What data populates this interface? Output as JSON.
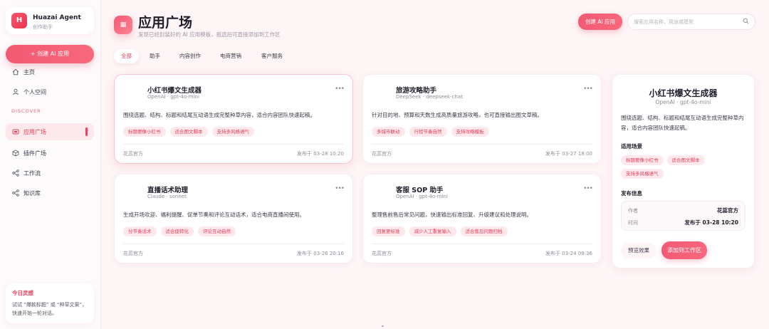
{
  "brand": {
    "logo_letter": "H",
    "name": "Huazai Agent",
    "subtitle": "创作助手"
  },
  "sidebar": {
    "create_label": "+  创建 AI 应用",
    "items_top": [
      {
        "label": "主页",
        "icon": "home-icon"
      },
      {
        "label": "个人空间",
        "icon": "user-icon"
      }
    ],
    "section_label": "DISCOVER",
    "items_discover": [
      {
        "label": "应用广场",
        "icon": "app-square-icon",
        "active": true
      },
      {
        "label": "插件广场",
        "icon": "cube-icon"
      },
      {
        "label": "工作流",
        "icon": "workflow-icon"
      },
      {
        "label": "知识库",
        "icon": "knowledge-icon"
      }
    ],
    "tip": {
      "title": "今日灵感",
      "text": "试试 “爆款标题” 或 “种草文案”，快速开始一轮对话。"
    }
  },
  "header": {
    "icon_glyph": "▦",
    "title": "应用广场",
    "subtitle": "发现已经封装好的 AI 应用模板，挑选后可直接添加到工作区",
    "create_button": "创建 AI 应用",
    "search_placeholder": "搜索应用名称、用途或模型"
  },
  "tabs": [
    {
      "label": "全部",
      "active": true
    },
    {
      "label": "助手"
    },
    {
      "label": "内容创作"
    },
    {
      "label": "电商营销"
    },
    {
      "label": "客户服务"
    }
  ],
  "cards": [
    {
      "title": "小红书爆文生成器",
      "model": "OpenAI · gpt-4o-mini",
      "description": "围绕选题、结构、标题和结尾互动语生成完整种草内容，适合内容团队快速起稿。",
      "tags": [
        "标题要像小红书",
        "适合图文脚本",
        "支持多风格语气"
      ],
      "author": "花蕊官方",
      "date": "发布于 03-28 10:20"
    },
    {
      "title": "旅游攻略助手",
      "model": "DeepSeek · deepseek-chat",
      "description": "针对目的地、预算和天数生成高质量旅游攻略，也可直接输出图文草稿。",
      "tags": [
        "多城市联动",
        "行程节奏自然",
        "支持攻略模板"
      ],
      "author": "花蕊官方",
      "date": "发布于 03-27 18:00"
    },
    {
      "title": "直播话术助理",
      "model": "Claude · sonnet",
      "description": "生成开场欢迎、福利提醒、促单节奏和评论互动话术，适合电商直播间使用。",
      "tags": [
        "分节奏话术",
        "适合促转化",
        "评论互动自然"
      ],
      "author": "花蕊官方",
      "date": "发布于 03-26 20:16"
    },
    {
      "title": "客服 SOP 助手",
      "model": "OpenAI · gpt-4o-mini",
      "description": "整理售前售后常见问题，快速输出标准回复、升级建议和处理说明。",
      "tags": [
        "回复更标准",
        "减少人工重复输入",
        "适合售后问题归档"
      ],
      "author": "花蕊官方",
      "date": "发布于 03-24 09:36"
    }
  ],
  "detail": {
    "title": "小红书爆文生成器",
    "model": "OpenAI · gpt-4o-mini",
    "description": "围绕选题、结构、标题和结尾互动语生成完整种草内容，适合内容团队快速起稿。",
    "scenario_label": "适用场景",
    "tags": [
      "标题要像小红书",
      "适合图文脚本",
      "支持多风格语气"
    ],
    "publish_label": "发布信息",
    "author_key": "作者",
    "author_value": "花蕊官方",
    "time_key": "时间",
    "time_value": "发布于 03-28 10:20",
    "preview_button": "预览效果",
    "add_button": "添加到工作区"
  },
  "scroll_hint": "⌄"
}
